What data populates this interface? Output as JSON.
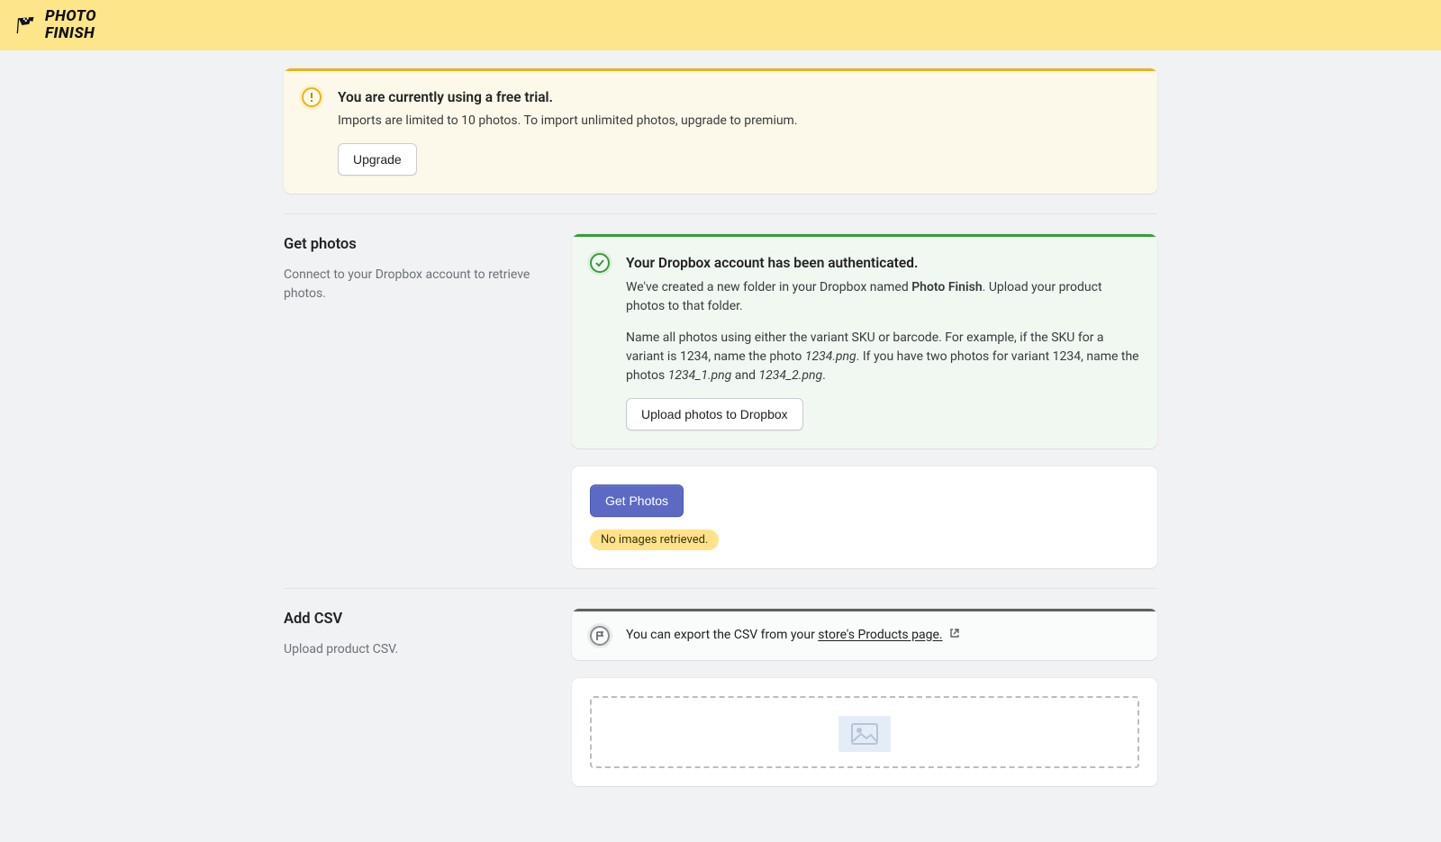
{
  "brand": {
    "name_line1": "PHOTO",
    "name_line2": "FINISH"
  },
  "trial_banner": {
    "title": "You are currently using a free trial.",
    "text": "Imports are limited to 10 photos. To import unlimited photos, upgrade to premium.",
    "button": "Upgrade"
  },
  "get_photos": {
    "heading": "Get photos",
    "subheading": "Connect to your Dropbox account to retrieve photos.",
    "auth_banner": {
      "title": "Your Dropbox account has been authenticated.",
      "p1_prefix": "We've created a new folder in your Dropbox named ",
      "p1_folder": "Photo Finish",
      "p1_suffix": ". Upload your product photos to that folder.",
      "p2_prefix": "Name all photos using either the variant SKU or barcode. For example, if the SKU for a variant is 1234, name the photo ",
      "p2_file1": "1234.png",
      "p2_mid": ". If you have two photos for variant 1234, name the photos ",
      "p2_file2": "1234_1.png",
      "p2_and": " and ",
      "p2_file3": "1234_2.png",
      "p2_end": ".",
      "button": "Upload photos to Dropbox"
    },
    "get_card": {
      "button": "Get Photos",
      "status": "No images retrieved."
    }
  },
  "add_csv": {
    "heading": "Add CSV",
    "subheading": "Upload product CSV.",
    "info_banner": {
      "prefix": "You can export the CSV from your ",
      "link": "store's Products page."
    }
  }
}
